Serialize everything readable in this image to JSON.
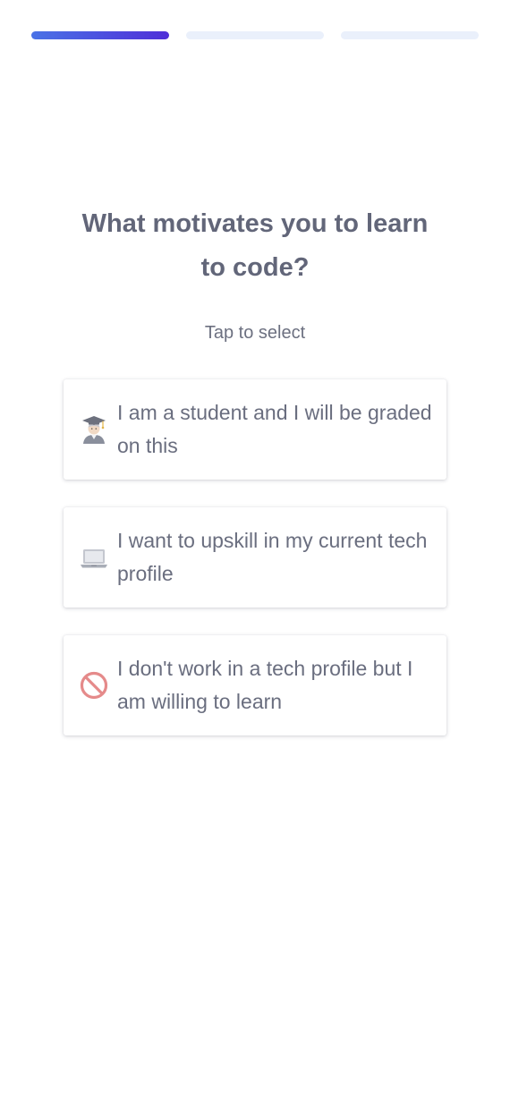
{
  "progress": {
    "total_steps": 3,
    "current_step": 1,
    "active_color": "#4f2fd8",
    "inactive_color": "#eaf0fb"
  },
  "question": {
    "title": "What motivates you to learn to code?",
    "hint": "Tap to select"
  },
  "options": [
    {
      "icon": "student-emoji-icon",
      "label": "I am a student and I will be graded on this"
    },
    {
      "icon": "laptop-emoji-icon",
      "label": "I want to upskill in my current tech profile"
    },
    {
      "icon": "prohibited-emoji-icon",
      "label": "I don't work in a tech profile but I am willing to learn"
    }
  ]
}
